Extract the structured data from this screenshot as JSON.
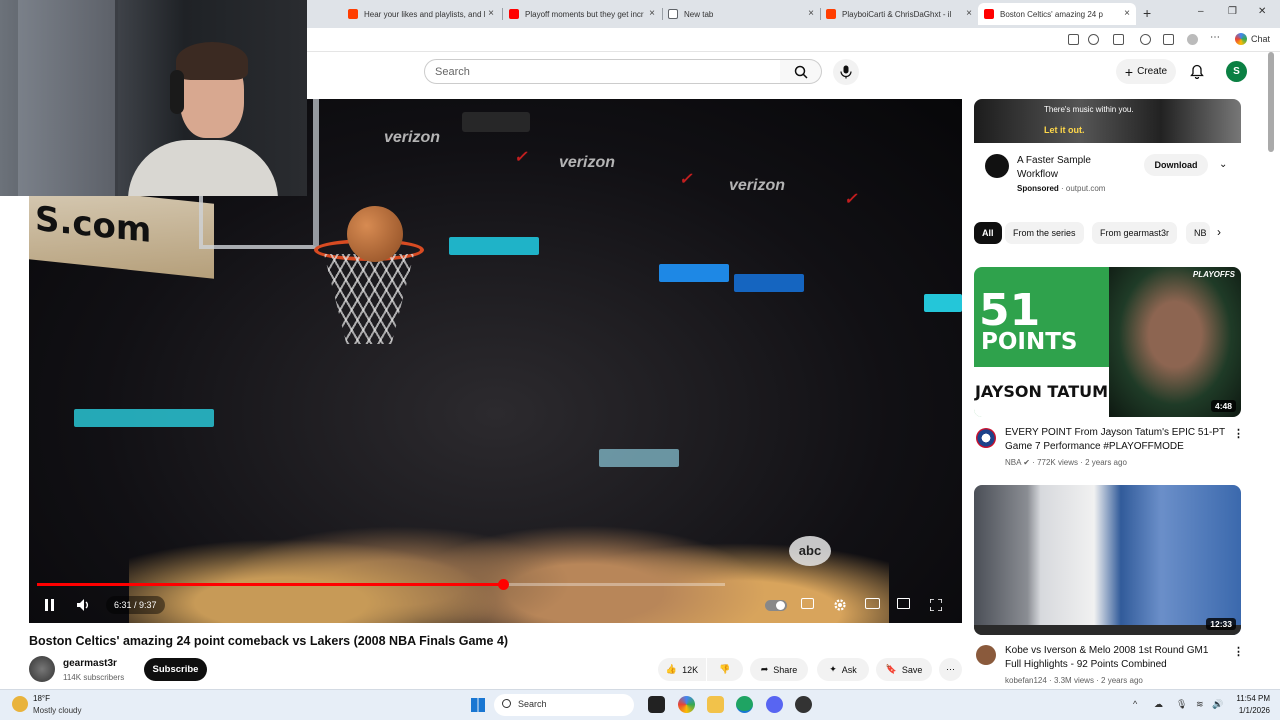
{
  "browser": {
    "tabs": [
      {
        "label": "Hear your likes and playlists, and l",
        "icon": "youtube-music-icon",
        "color": "#ff3d00"
      },
      {
        "label": "Playoff moments but they get incr",
        "icon": "youtube-icon",
        "color": "#ff0000"
      },
      {
        "label": "New tab",
        "icon": "new-tab-icon",
        "color": "#5f6368"
      },
      {
        "label": "PlayboiCarti & ChrisDaGhxt - il",
        "icon": "youtube-music-icon",
        "color": "#ff3d00"
      },
      {
        "label": "Boston Celtics' amazing 24 p",
        "icon": "youtube-icon",
        "color": "#ff0000",
        "active": true
      }
    ],
    "new_tab_symbol": "+",
    "close_symbol": "×",
    "window_controls": [
      "–",
      "❐",
      "✕"
    ],
    "chat_label": "Chat"
  },
  "youtube": {
    "search_placeholder": "Search",
    "create_label": "Create",
    "avatar_letter": "S"
  },
  "player": {
    "time_display": "6:31 / 9:37",
    "progress_fraction": 0.6768,
    "buffer_fraction": 1.0,
    "watermark": "abc"
  },
  "video": {
    "title": "Boston Celtics' amazing 24 point comeback vs Lakers (2008 NBA Finals Game 4)",
    "channel": "gearmast3r",
    "subscribers": "114K subscribers",
    "subscribe_label": "Subscribe",
    "likes": "12K",
    "share_label": "Share",
    "ask_label": "Ask",
    "save_label": "Save"
  },
  "sidebar": {
    "ad": {
      "banner_text": "There's music within you.",
      "banner_cta": "Let it out.",
      "title": "A Faster Sample Workflow",
      "sponsored": "Sponsored",
      "domain": "output.com",
      "download_label": "Download"
    },
    "chips": [
      "All",
      "From the series",
      "From gearmast3r",
      "NB"
    ],
    "videos": [
      {
        "thumb_big": "51",
        "thumb_points": "POINTS",
        "thumb_name": "JAYSON TATUM",
        "thumb_badge": "PLAYOFFS",
        "duration": "4:48",
        "title": "EVERY POINT From Jayson Tatum's EPIC 51-PT Game 7 Performance #PLAYOFFMODE",
        "channel": "NBA",
        "meta": "772K views · 2 years ago"
      },
      {
        "duration": "12:33",
        "title": "Kobe vs Iverson & Melo 2008 1st Round GM1 Full Highlights - 92 Points Combined",
        "channel": "kobefan124",
        "meta": "3.3M views · 2 years ago"
      }
    ]
  },
  "taskbar": {
    "temperature": "18°F",
    "weather": "Mostly cloudy",
    "search_label": "Search",
    "time": "11:54 PM",
    "date": "1/1/2026"
  }
}
